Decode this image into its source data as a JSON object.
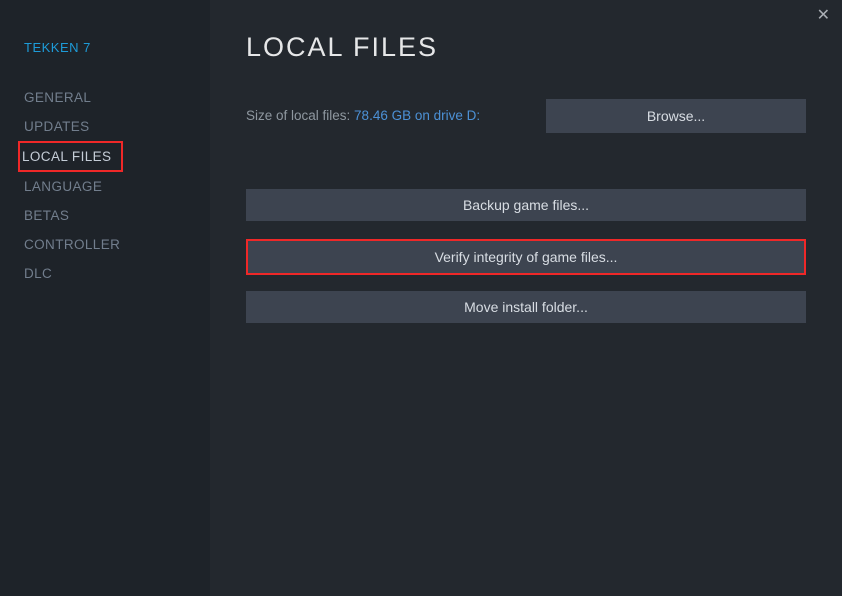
{
  "game_title": "TEKKEN 7",
  "sidebar": {
    "items": [
      {
        "label": "GENERAL",
        "active": false
      },
      {
        "label": "UPDATES",
        "active": false
      },
      {
        "label": "LOCAL FILES",
        "active": true,
        "highlighted": true
      },
      {
        "label": "LANGUAGE",
        "active": false
      },
      {
        "label": "BETAS",
        "active": false
      },
      {
        "label": "CONTROLLER",
        "active": false
      },
      {
        "label": "DLC",
        "active": false
      }
    ]
  },
  "main": {
    "title": "LOCAL FILES",
    "size_label": "Size of local files: ",
    "size_value": "78.46 GB on drive D:",
    "browse_label": "Browse...",
    "buttons": [
      {
        "label": "Backup game files...",
        "highlighted": false
      },
      {
        "label": "Verify integrity of game files...",
        "highlighted": true
      },
      {
        "label": "Move install folder...",
        "highlighted": false
      }
    ]
  }
}
